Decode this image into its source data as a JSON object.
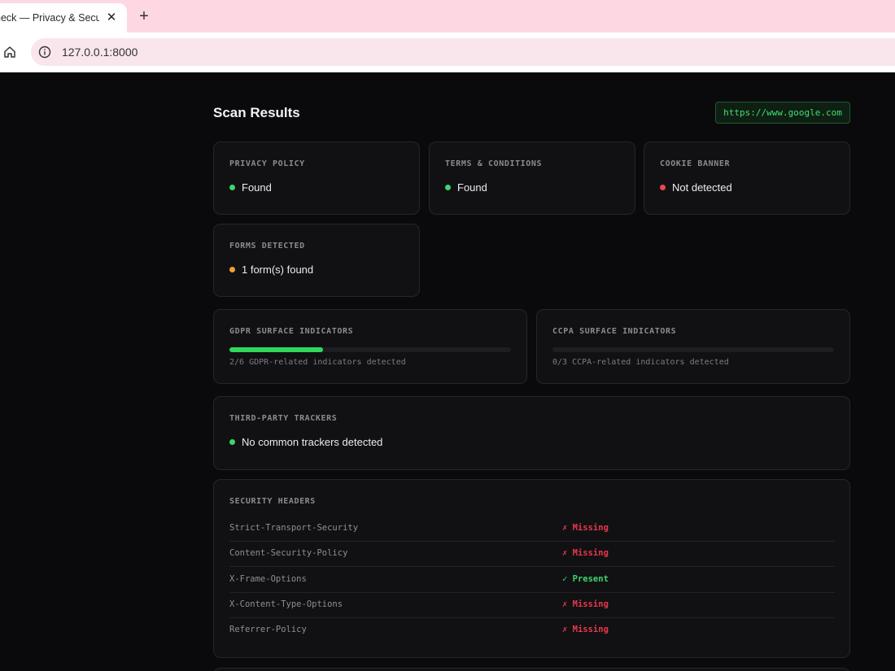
{
  "browser": {
    "tab_title": "heck — Privacy & Secu",
    "tab_close": "✕",
    "new_tab": "+",
    "url": "127.0.0.1:8000"
  },
  "page": {
    "heading": "Scan Results",
    "scanned_url": "https://www.google.com"
  },
  "cards": {
    "privacy_policy": {
      "label": "PRIVACY POLICY",
      "value": "Found",
      "status": "green"
    },
    "terms": {
      "label": "TERMS & CONDITIONS",
      "value": "Found",
      "status": "green"
    },
    "cookie_banner": {
      "label": "COOKIE BANNER",
      "value": "Not detected",
      "status": "red"
    },
    "forms": {
      "label": "FORMS DETECTED",
      "value": "1 form(s) found",
      "status": "orange"
    }
  },
  "indicators": {
    "gdpr": {
      "label": "GDPR SURFACE INDICATORS",
      "note": "2/6 GDPR-related indicators detected",
      "fraction": 0.333
    },
    "ccpa": {
      "label": "CCPA SURFACE INDICATORS",
      "note": "0/3 CCPA-related indicators detected",
      "fraction": 0
    }
  },
  "trackers": {
    "label": "THIRD-PARTY TRACKERS",
    "value": "No common trackers detected",
    "status": "green"
  },
  "security_headers": {
    "label": "SECURITY HEADERS",
    "rows": [
      {
        "name": "Strict-Transport-Security",
        "status": "✗ Missing",
        "state": "missing"
      },
      {
        "name": "Content-Security-Policy",
        "status": "✗ Missing",
        "state": "missing"
      },
      {
        "name": "X-Frame-Options",
        "status": "✓ Present",
        "state": "present"
      },
      {
        "name": "X-Content-Type-Options",
        "status": "✗ Missing",
        "state": "missing"
      },
      {
        "name": "Referrer-Policy",
        "status": "✗ Missing",
        "state": "missing"
      }
    ]
  },
  "colors": {
    "found": "#3ed66a",
    "missing": "#e8384a",
    "warning": "#f2a02e",
    "accent": "#2fd85c"
  }
}
